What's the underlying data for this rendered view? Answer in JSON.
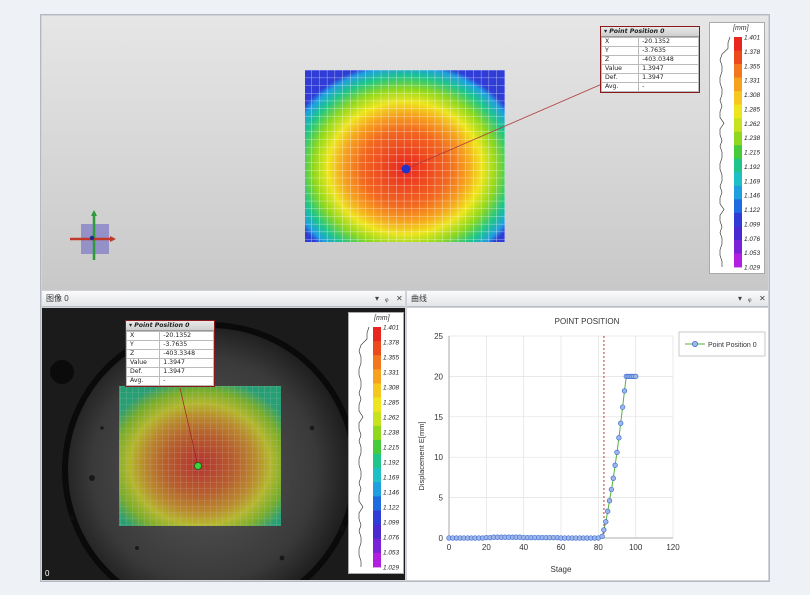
{
  "point_table": {
    "title": "Point Position 0",
    "rows": [
      {
        "label": "X",
        "value": "-20.1352"
      },
      {
        "label": "Y",
        "value": "-3.7635"
      },
      {
        "label": "Z",
        "value": "-403.0348"
      },
      {
        "label": "Value",
        "value": "1.3947"
      },
      {
        "label": "Def.",
        "value": "1.3947"
      },
      {
        "label": "Avg.",
        "value": "-"
      }
    ]
  },
  "point_table_image": {
    "title": "Point Position 0",
    "rows": [
      {
        "label": "X",
        "value": "-20.1352"
      },
      {
        "label": "Y",
        "value": "-3.7635"
      },
      {
        "label": "Z",
        "value": "-403.3348"
      },
      {
        "label": "Value",
        "value": "1.3947"
      },
      {
        "label": "Def.",
        "value": "1.3947"
      },
      {
        "label": "Avg.",
        "value": "-"
      }
    ]
  },
  "colorbar": {
    "unit": "[mm]",
    "labels": [
      "1.401",
      "1.378",
      "1.355",
      "1.331",
      "1.308",
      "1.285",
      "1.262",
      "1.238",
      "1.215",
      "1.192",
      "1.169",
      "1.146",
      "1.122",
      "1.099",
      "1.076",
      "1.053",
      "1.029"
    ],
    "colors": [
      "#e8251f",
      "#ec4a1d",
      "#f2771f",
      "#f6a21f",
      "#f6c81f",
      "#eee51f",
      "#c7e31f",
      "#8fd81f",
      "#46cc3a",
      "#1fc58a",
      "#1fbfc6",
      "#1f9fe0",
      "#1f6ce0",
      "#2f3dd6",
      "#4a2ad0",
      "#7a22d8",
      "#b21fe0"
    ]
  },
  "image_panel": {
    "title": "图像 0",
    "frame_number": "0",
    "controls": [
      "▾",
      "ᵩ",
      "✕"
    ]
  },
  "curve_panel": {
    "title": "曲线",
    "controls": [
      "▾",
      "ᵩ",
      "✕"
    ]
  },
  "colors": {
    "accent_red": "#c0392b",
    "series": "#3f6fd1",
    "trend": "#56b23a"
  },
  "chart_data": {
    "type": "line",
    "title": "POINT POSITION",
    "xlabel": "Stage",
    "ylabel": "Displacement E[mm]",
    "xlim": [
      0,
      120
    ],
    "ylim": [
      0,
      25
    ],
    "xticks": [
      0,
      20,
      40,
      60,
      80,
      100,
      120
    ],
    "yticks": [
      0,
      5,
      10,
      15,
      20,
      25
    ],
    "vline_x": 83,
    "series": [
      {
        "name": "Point Position 0",
        "x": [
          0,
          2,
          4,
          6,
          8,
          10,
          12,
          14,
          16,
          18,
          20,
          22,
          24,
          26,
          28,
          30,
          32,
          34,
          36,
          38,
          40,
          42,
          44,
          46,
          48,
          50,
          52,
          54,
          56,
          58,
          60,
          62,
          64,
          66,
          68,
          70,
          72,
          74,
          76,
          78,
          80,
          82,
          83,
          84,
          85,
          86,
          87,
          88,
          89,
          90,
          91,
          92,
          93,
          94,
          95,
          96,
          97,
          98,
          99,
          100
        ],
        "y": [
          0,
          0,
          0,
          0,
          0,
          0,
          0,
          0,
          0,
          0,
          0.05,
          0.05,
          0.1,
          0.1,
          0.1,
          0.1,
          0.1,
          0.1,
          0.1,
          0.1,
          0.05,
          0.05,
          0.05,
          0.05,
          0.05,
          0.05,
          0.05,
          0.05,
          0.05,
          0.05,
          0,
          0,
          0,
          0,
          0,
          0,
          0,
          0,
          0,
          0,
          0,
          0.2,
          1.0,
          2.0,
          3.3,
          4.6,
          6.0,
          7.4,
          9.0,
          10.6,
          12.4,
          14.2,
          16.2,
          18.2,
          20.0,
          20.0,
          20.0,
          20.0,
          20.0,
          20.0
        ]
      }
    ]
  }
}
